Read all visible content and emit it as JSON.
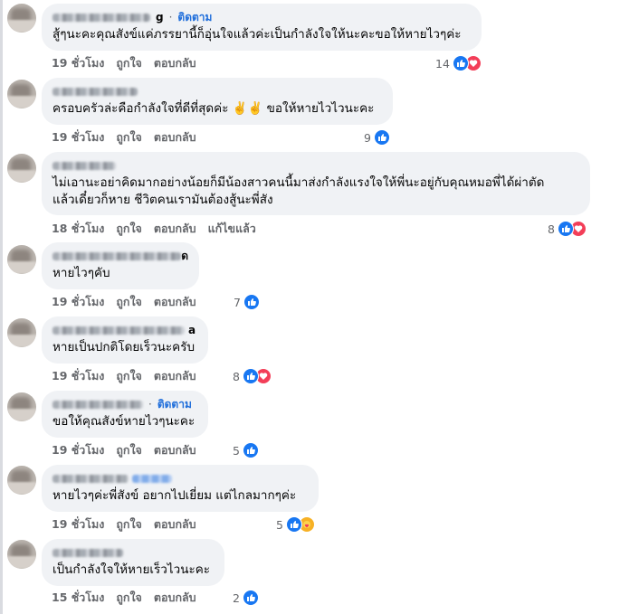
{
  "colors": {
    "bubble": "#f0f2f5",
    "link_blue": "#216fdb",
    "like_blue": "#1877f2",
    "love_red": "#f33e58",
    "care_yellow": "#f7b125",
    "meta_gray": "#65676b"
  },
  "comments": [
    {
      "name_tail": "g",
      "follow_label": "ติดตาม",
      "text": "สู้ๆนะคะคุณสังข์แค่ภรรยานี้ก็อุ่นใจแล้วค่ะเป็นกำลังใจให้นะคะขอให้หายไวๆค่ะ",
      "time": "19 ชั่วโมง",
      "like_label": "ถูกใจ",
      "reply_label": "ตอบกลับ",
      "reaction_count": "14",
      "reactions": [
        "like-icon",
        "love-icon"
      ]
    },
    {
      "name_tail": "",
      "follow_label": "",
      "text": "ครอบครัวล่ะคือกำลังใจที่ดีที่สุดค่ะ ✌️✌️ ขอให้หายไวไวนะคะ",
      "time": "19 ชั่วโมง",
      "like_label": "ถูกใจ",
      "reply_label": "ตอบกลับ",
      "reaction_count": "9",
      "reactions": [
        "like-icon"
      ]
    },
    {
      "name_tail": "",
      "follow_label": "",
      "text_line1": "ไม่เอานะอย่าคิดมากอย่างน้อยก็มีน้องสาวคนนี้มาส่งกำลังแรงใจให้พี่นะอยู่กับคุณหมอพี่ได้ผ่าตัด",
      "text_line2": "แล้วเดี๋ยวก็หาย ชีวิตคนเรามันต้องสู้นะพี่สัง",
      "time": "18 ชั่วโมง",
      "like_label": "ถูกใจ",
      "reply_label": "ตอบกลับ",
      "edited_label": "แก้ไขแล้ว",
      "reaction_count": "8",
      "reactions": [
        "like-icon",
        "love-icon"
      ]
    },
    {
      "name_tail": "ด",
      "follow_label": "",
      "text": "หายไวๆคับ",
      "time": "19 ชั่วโมง",
      "like_label": "ถูกใจ",
      "reply_label": "ตอบกลับ",
      "reaction_count": "7",
      "reactions": [
        "like-icon"
      ]
    },
    {
      "name_tail": "a",
      "follow_label": "",
      "text": "หายเป็นปกติโดยเร็วนะครับ",
      "time": "19 ชั่วโมง",
      "like_label": "ถูกใจ",
      "reply_label": "ตอบกลับ",
      "reaction_count": "8",
      "reactions": [
        "like-icon",
        "love-icon"
      ]
    },
    {
      "name_tail": "",
      "follow_label": "ติดตาม",
      "text": "ขอให้คุณสังข์หายไวๆนะคะ",
      "time": "19 ชั่วโมง",
      "like_label": "ถูกใจ",
      "reply_label": "ตอบกลับ",
      "reaction_count": "5",
      "reactions": [
        "like-icon"
      ]
    },
    {
      "name_tail": "",
      "follow_label": "",
      "text": "หายไวๆค่ะพี่สังข์ อยากไปเยี่ยม แต่ไกลมากๆค่ะ",
      "time": "19 ชั่วโมง",
      "like_label": "ถูกใจ",
      "reply_label": "ตอบกลับ",
      "reaction_count": "5",
      "reactions": [
        "like-icon",
        "care-icon"
      ]
    },
    {
      "name_tail": "",
      "follow_label": "",
      "text": "เป็นกำลังใจให้หายเร็วไวนะคะ",
      "time": "15 ชั่วโมง",
      "like_label": "ถูกใจ",
      "reply_label": "ตอบกลับ",
      "reaction_count": "2",
      "reactions": [
        "like-icon"
      ]
    }
  ]
}
